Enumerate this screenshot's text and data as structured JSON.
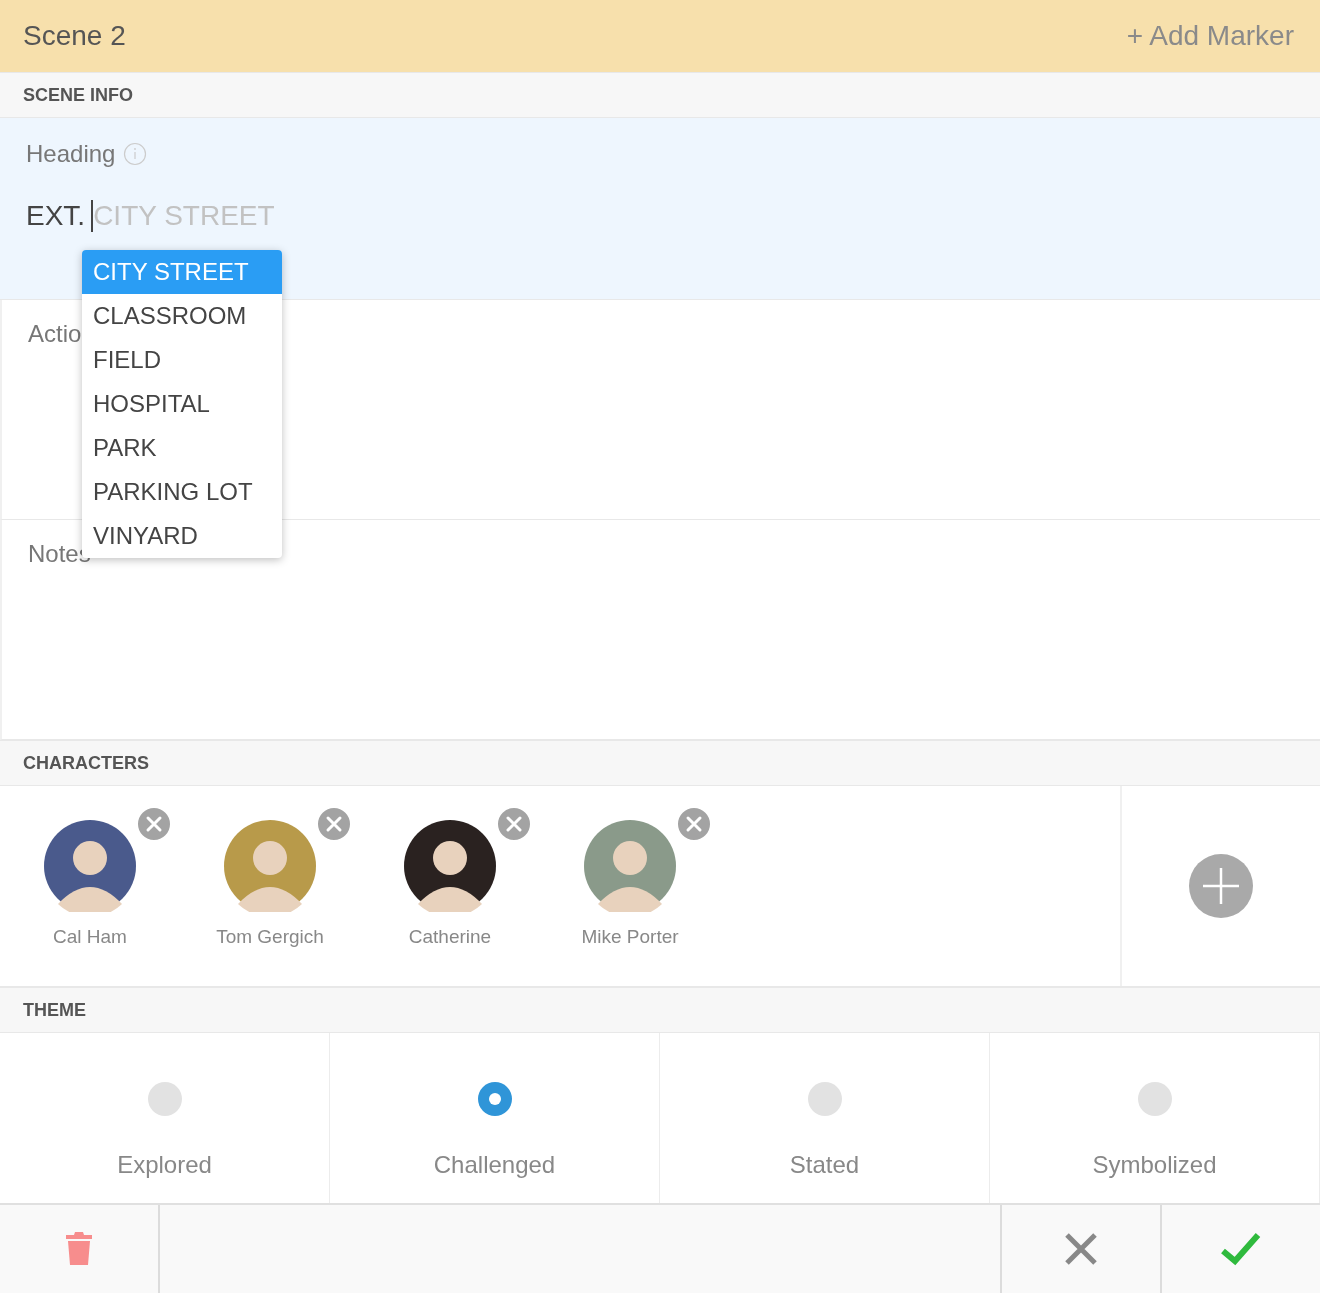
{
  "header": {
    "title": "Scene 2",
    "action": "+ Add Marker"
  },
  "scene_info": {
    "section_title": "SCENE INFO",
    "heading": {
      "label": "Heading",
      "prefix": "EXT.",
      "placeholder": "CITY STREET"
    },
    "suggestions": [
      {
        "label": "CITY STREET",
        "selected": true
      },
      {
        "label": "CLASSROOM",
        "selected": false
      },
      {
        "label": "FIELD",
        "selected": false
      },
      {
        "label": "HOSPITAL",
        "selected": false
      },
      {
        "label": "PARK",
        "selected": false
      },
      {
        "label": "PARKING LOT",
        "selected": false
      },
      {
        "label": "VINYARD",
        "selected": false
      }
    ],
    "action": {
      "label": "Actio"
    },
    "notes": {
      "label": "Notes"
    }
  },
  "characters": {
    "section_title": "CHARACTERS",
    "items": [
      {
        "name": "Cal Ham",
        "color": "#4a5a8c"
      },
      {
        "name": "Tom Gergich",
        "color": "#b89a4a"
      },
      {
        "name": "Catherine",
        "color": "#2a2220"
      },
      {
        "name": "Mike Porter",
        "color": "#8a9a8a"
      }
    ]
  },
  "theme": {
    "section_title": "THEME",
    "options": [
      {
        "label": "Explored",
        "selected": false
      },
      {
        "label": "Challenged",
        "selected": true
      },
      {
        "label": "Stated",
        "selected": false
      },
      {
        "label": "Symbolized",
        "selected": false
      }
    ]
  }
}
